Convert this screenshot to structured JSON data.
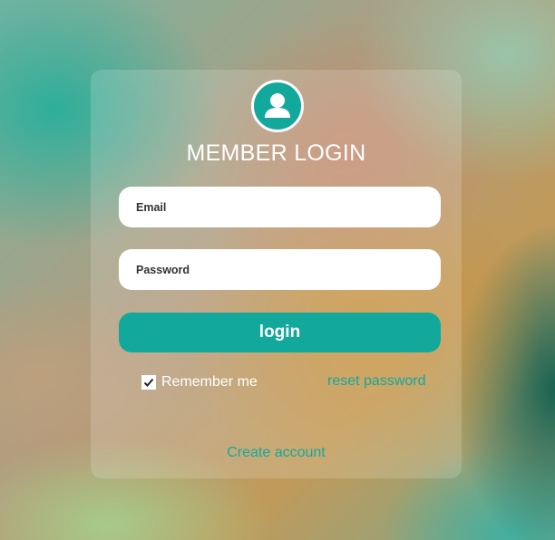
{
  "login_form": {
    "title": "MEMBER LOGIN",
    "email_placeholder": "Email",
    "password_placeholder": "Password",
    "login_label": "login",
    "remember_label": "Remember me",
    "remember_checked": true,
    "reset_label": "reset password",
    "create_account_label": "Create account",
    "avatar_icon": "user-icon"
  },
  "colors": {
    "accent": "#13a89c",
    "card_text": "#ffffff",
    "field_bg": "#ffffff"
  }
}
